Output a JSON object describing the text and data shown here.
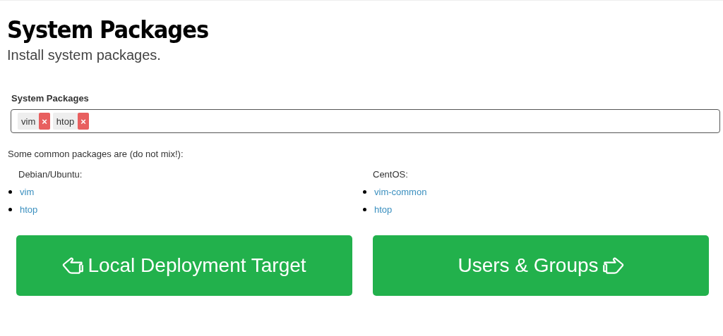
{
  "header": {
    "title": "System Packages",
    "subtitle": "Install system packages."
  },
  "field": {
    "label": "System Packages",
    "tags": [
      {
        "text": "vim",
        "remove": "×"
      },
      {
        "text": "htop",
        "remove": "×"
      }
    ]
  },
  "note": "Some common packages are (do not mix!):",
  "columns": [
    {
      "heading": "Debian/Ubuntu:",
      "items": [
        "vim",
        "htop"
      ]
    },
    {
      "heading": "CentOS:",
      "items": [
        "vim-common",
        "htop"
      ]
    }
  ],
  "buttons": [
    {
      "label": "Local Deployment Target",
      "kind": "back"
    },
    {
      "label": "Users & Groups",
      "kind": "next"
    }
  ]
}
